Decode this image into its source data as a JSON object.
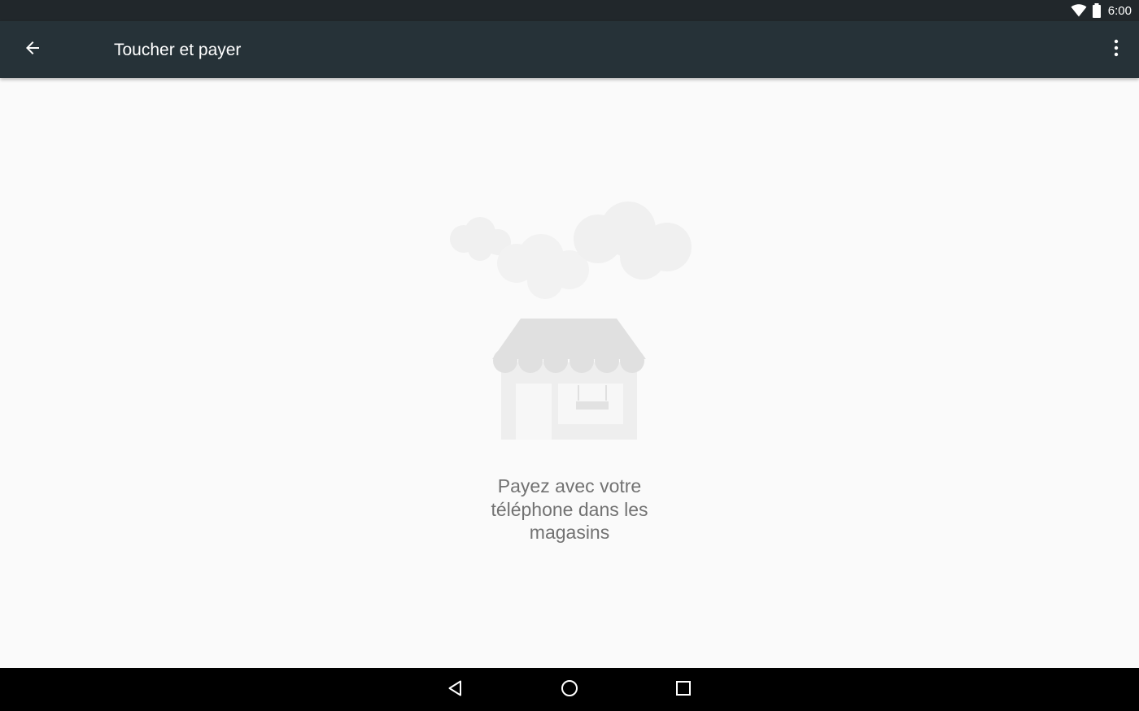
{
  "status_bar": {
    "time": "6:00",
    "icons": [
      "wifi-icon",
      "battery-icon"
    ]
  },
  "app_bar": {
    "title": "Toucher et payer",
    "back_icon": "arrow-back-icon",
    "overflow_icon": "more-vert-icon"
  },
  "content": {
    "illustration": "store-with-clouds",
    "message": "Payez avec votre téléphone dans les magasins"
  },
  "nav_bar": {
    "icons": [
      "back-triangle-icon",
      "home-circle-icon",
      "recents-square-icon"
    ]
  },
  "colors": {
    "status_bar": "#21272b",
    "app_bar": "#263238",
    "background": "#fafafa",
    "message_text": "#727272",
    "nav_bar": "#000000"
  }
}
